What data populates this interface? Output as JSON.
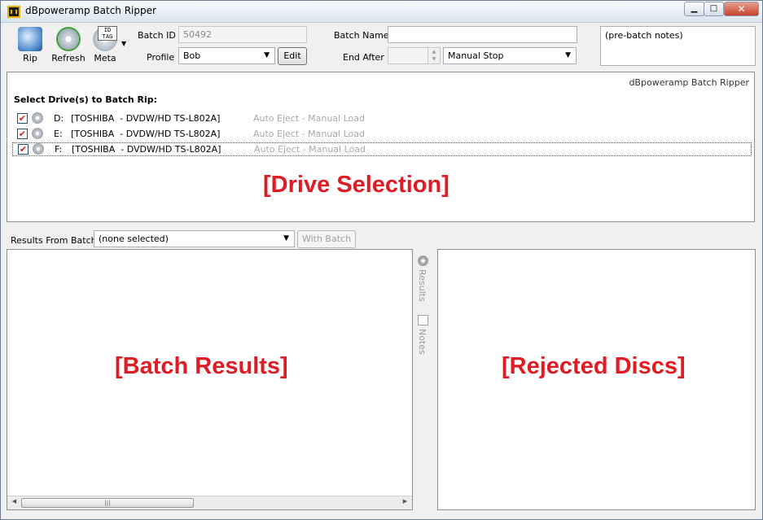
{
  "window": {
    "title": "dBpoweramp Batch Ripper"
  },
  "toolbar": {
    "rip_label": "Rip",
    "refresh_label": "Refresh",
    "meta_label": "Meta",
    "meta_tag": "ID TAG"
  },
  "form": {
    "batch_id_label": "Batch ID",
    "batch_id_value": "50492",
    "profile_label": "Profile",
    "profile_value": "Bob",
    "edit_label": "Edit",
    "batch_name_label": "Batch Name",
    "batch_name_value": "",
    "end_after_label": "End After",
    "end_after_value": "",
    "end_mode_value": "Manual Stop",
    "notes_value": "(pre-batch notes)"
  },
  "drive_panel": {
    "caption": "dBpoweramp Batch Ripper",
    "heading": "Select Drive(s) to Batch Rip:",
    "drives": [
      {
        "letter": "D:",
        "name": "[TOSHIBA  - DVDW/HD TS-L802A]",
        "status": "Auto Eject - Manual Load",
        "checked": true
      },
      {
        "letter": "E:",
        "name": "[TOSHIBA  - DVDW/HD TS-L802A]",
        "status": "Auto Eject - Manual Load",
        "checked": true
      },
      {
        "letter": "F:",
        "name": "[TOSHIBA  - DVDW/HD TS-L802A]",
        "status": "Auto Eject - Manual Load",
        "checked": true
      }
    ],
    "placeholder": "[Drive Selection]"
  },
  "results": {
    "label": "Results From Batch",
    "selected": "(none selected)",
    "with_batch_label": "With Batch >"
  },
  "side_tabs": {
    "results": "Results",
    "notes": "Notes"
  },
  "left_pane": {
    "placeholder": "[Batch Results]"
  },
  "right_pane": {
    "placeholder": "[Rejected Discs]"
  },
  "colors": {
    "placeholder_red": "#e01b24",
    "check_red": "#d81c1c"
  }
}
